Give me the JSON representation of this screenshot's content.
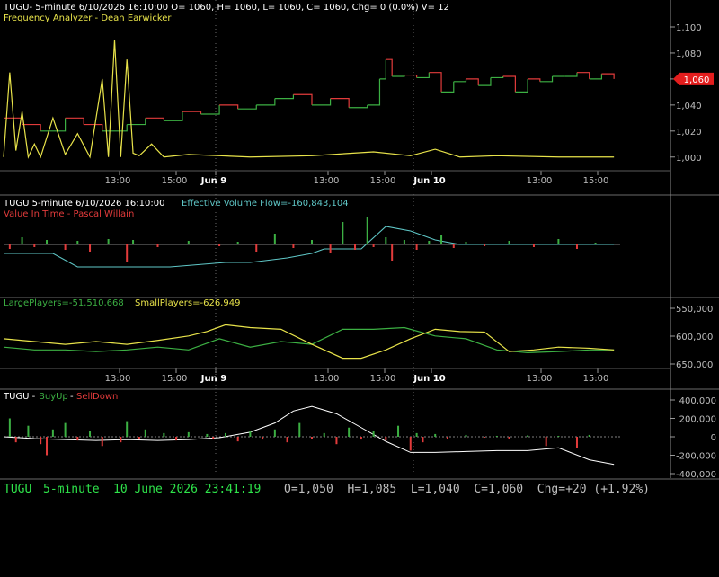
{
  "colors": {
    "background": "#000000",
    "axis": "#9a9a9a",
    "grid": "#3a3a3a",
    "up": "#3cb043",
    "down": "#e23b3b",
    "yellow": "#e8e34a",
    "cyan": "#5fc7c7",
    "white": "#ffffff",
    "status_green": "#2ee34a",
    "status_gray": "#bfbfbf",
    "price_tag": "#e31d1d"
  },
  "panels": {
    "price": {
      "header": "TUGU- 5-minute 6/10/2026 16:10:00 O= 1060, H= 1060, L= 1060, C= 1060, Chg= 0 (0.0%) V= 12",
      "indicator": "Frequency Analyzer - Dean Earwicker",
      "y_ticks": [
        "1,100",
        "1,080",
        "1,060",
        "1,040",
        "1,020",
        "1,000"
      ],
      "last_price_tag": "1,060"
    },
    "volume_flow": {
      "header_prefix": "TUGU 5-minute  6/10/2026 16:10:00",
      "header_value": "Effective Volume Flow=-160,843,104",
      "indicator": "Value In Time - Pascal Willain"
    },
    "players": {
      "large_label": "LargePlayers=-51,510,668",
      "small_label": "SmallPlayers=-626,949",
      "y_ticks": [
        "550,000",
        "600,000",
        "650,000"
      ]
    },
    "buyup": {
      "ticker": "TUGU - ",
      "buy_label": "BuyUp",
      "sep": "-",
      "sell_label": "SellDown",
      "y_ticks": [
        "400,000",
        "200,000",
        "0",
        "-200,000",
        "-400,000"
      ]
    }
  },
  "x_axis": {
    "ticks": [
      "13:00",
      "15:00",
      "Jun 9",
      "13:00",
      "15:00",
      "Jun 10",
      "13:00",
      "15:00"
    ]
  },
  "status_bar": {
    "symbol": "TUGU",
    "interval": "5-minute",
    "datetime": "10 June 2026 23:41:19",
    "ohlc": "O=1,050  H=1,085  L=1,040  C=1,060  Chg=+20 (+1.92%)"
  },
  "chart_data": [
    {
      "type": "line",
      "name": "price",
      "x_range": [
        0,
        100
      ],
      "ylim": [
        995,
        1100
      ],
      "series": [
        {
          "name": "price",
          "x": [
            0,
            3,
            6,
            10,
            13,
            16,
            20,
            23,
            26,
            29,
            32,
            35,
            38,
            41,
            44,
            47,
            50,
            53,
            56,
            59,
            61,
            62,
            63,
            65,
            67,
            69,
            71,
            73,
            75,
            77,
            79,
            81,
            83,
            85,
            87,
            89,
            91,
            93,
            95,
            97,
            99
          ],
          "values": [
            1030,
            1025,
            1020,
            1030,
            1025,
            1020,
            1025,
            1030,
            1028,
            1035,
            1033,
            1040,
            1037,
            1040,
            1045,
            1048,
            1040,
            1045,
            1038,
            1040,
            1060,
            1075,
            1062,
            1063,
            1061,
            1065,
            1050,
            1058,
            1060,
            1055,
            1061,
            1062,
            1050,
            1060,
            1058,
            1062,
            1062,
            1065,
            1060,
            1064,
            1060
          ]
        },
        {
          "name": "Frequency Analyzer",
          "x": [
            0,
            1,
            2,
            3,
            4,
            5,
            6,
            8,
            10,
            12,
            14,
            16,
            17,
            18,
            19,
            20,
            21,
            22,
            24,
            26,
            30,
            35,
            40,
            50,
            60,
            66,
            70,
            74,
            80,
            90,
            99
          ],
          "values": [
            1000,
            1065,
            1005,
            1035,
            1000,
            1010,
            1000,
            1030,
            1002,
            1018,
            1000,
            1060,
            1000,
            1090,
            1000,
            1075,
            1003,
            1001,
            1010,
            1000,
            1002,
            1001,
            1000,
            1001,
            1004,
            1001,
            1006,
            1000,
            1001,
            1000,
            1000
          ]
        }
      ]
    },
    {
      "type": "bar",
      "name": "volume_flow",
      "x_range": [
        0,
        100
      ],
      "series": [
        {
          "name": "Effective Volume Flow",
          "x": [
            0,
            8,
            12,
            20,
            27,
            36,
            40,
            46,
            50,
            52,
            58,
            62,
            66,
            70,
            74,
            80,
            86,
            90,
            99
          ],
          "values": [
            -10,
            -10,
            -25,
            -25,
            -25,
            -20,
            -20,
            -15,
            -10,
            -5,
            -5,
            20,
            15,
            5,
            0,
            0,
            0,
            0,
            0
          ]
        },
        {
          "name": "Value In Time",
          "x": [
            1,
            3,
            5,
            7,
            10,
            12,
            14,
            17,
            20,
            21,
            25,
            30,
            35,
            38,
            41,
            44,
            47,
            50,
            53,
            55,
            57,
            59,
            60,
            62,
            63,
            65,
            67,
            69,
            71,
            73,
            75,
            78,
            82,
            86,
            90,
            93,
            96
          ],
          "values": [
            -5,
            8,
            -3,
            5,
            -6,
            4,
            -8,
            6,
            -20,
            5,
            -3,
            4,
            -2,
            3,
            -8,
            12,
            -4,
            5,
            -10,
            25,
            -6,
            30,
            -3,
            8,
            -18,
            5,
            -6,
            4,
            10,
            -4,
            3,
            -2,
            4,
            -3,
            6,
            -5,
            2
          ]
        }
      ]
    },
    {
      "type": "line",
      "name": "players",
      "x_range": [
        0,
        100
      ],
      "ylim": [
        660000,
        540000
      ],
      "series": [
        {
          "name": "LargePlayers",
          "x": [
            0,
            5,
            10,
            15,
            20,
            25,
            30,
            35,
            40,
            45,
            50,
            55,
            60,
            65,
            70,
            75,
            80,
            85,
            90,
            95,
            99
          ],
          "values": [
            610000,
            615000,
            615000,
            618000,
            615000,
            610000,
            615000,
            595000,
            610000,
            600000,
            605000,
            578000,
            578000,
            575000,
            590000,
            595000,
            615000,
            620000,
            618000,
            615000,
            615000
          ]
        },
        {
          "name": "SmallPlayers",
          "x": [
            0,
            5,
            10,
            15,
            20,
            25,
            30,
            33,
            36,
            40,
            45,
            50,
            55,
            58,
            62,
            66,
            70,
            74,
            78,
            82,
            86,
            90,
            95,
            99
          ],
          "values": [
            595000,
            600000,
            605000,
            600000,
            605000,
            598000,
            590000,
            582000,
            570000,
            575000,
            578000,
            605000,
            630000,
            630000,
            615000,
            595000,
            578000,
            582000,
            583000,
            618000,
            615000,
            610000,
            612000,
            615000
          ]
        }
      ]
    },
    {
      "type": "bar",
      "name": "buyup",
      "x_range": [
        0,
        100
      ],
      "ylim": [
        -400000,
        450000
      ],
      "series": [
        {
          "name": "cumulative",
          "x": [
            0,
            5,
            10,
            15,
            20,
            25,
            30,
            35,
            40,
            44,
            47,
            50,
            54,
            58,
            62,
            66,
            70,
            75,
            80,
            85,
            90,
            95,
            99
          ],
          "values": [
            0,
            -20000,
            -30000,
            -40000,
            -30000,
            -40000,
            -30000,
            -10000,
            50000,
            150000,
            280000,
            330000,
            250000,
            100000,
            -50000,
            -170000,
            -170000,
            -160000,
            -150000,
            -150000,
            -120000,
            -250000,
            -300000
          ]
        },
        {
          "name": "BuyUp",
          "x": [
            1,
            4,
            8,
            10,
            14,
            20,
            23,
            26,
            30,
            33,
            36,
            40,
            44,
            48,
            52,
            56,
            60,
            64,
            67,
            70,
            75,
            80,
            85,
            90,
            95
          ],
          "values": [
            200000,
            120000,
            80000,
            150000,
            60000,
            170000,
            80000,
            40000,
            50000,
            30000,
            40000,
            60000,
            80000,
            150000,
            40000,
            100000,
            60000,
            120000,
            40000,
            30000,
            20000,
            10000,
            15000,
            10000,
            20000
          ]
        },
        {
          "name": "SellDown",
          "x": [
            2,
            6,
            7,
            12,
            16,
            19,
            22,
            28,
            34,
            38,
            42,
            46,
            50,
            54,
            58,
            62,
            66,
            68,
            72,
            78,
            82,
            88,
            93
          ],
          "values": [
            -60000,
            -80000,
            -200000,
            -40000,
            -100000,
            -60000,
            -30000,
            -40000,
            -20000,
            -50000,
            -30000,
            -60000,
            -20000,
            -80000,
            -30000,
            -40000,
            -150000,
            -60000,
            -20000,
            -10000,
            -20000,
            -100000,
            -120000
          ]
        }
      ]
    }
  ]
}
